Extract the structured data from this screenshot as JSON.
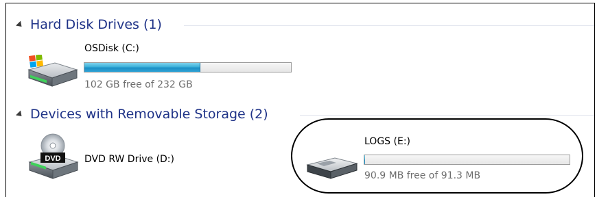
{
  "groups": [
    {
      "title": "Hard Disk Drives (1)",
      "drives": [
        {
          "name": "OSDisk (C:)",
          "free_text": "102 GB free of 232 GB",
          "used_fraction": 0.56,
          "icon": "windows-hard-drive-icon"
        }
      ]
    },
    {
      "title": "Devices with Removable Storage (2)",
      "drives": [
        {
          "name": "DVD RW Drive (D:)",
          "icon": "dvd-drive-icon",
          "icon_label": "DVD"
        },
        {
          "name": "LOGS (E:)",
          "free_text": "90.9 MB free of 91.3 MB",
          "used_fraction": 0.004,
          "icon": "removable-drive-icon"
        }
      ]
    }
  ],
  "colors": {
    "group_title": "#1e3287",
    "bar_fill": "#2fa3d6",
    "free_text": "#6d6d6d"
  }
}
